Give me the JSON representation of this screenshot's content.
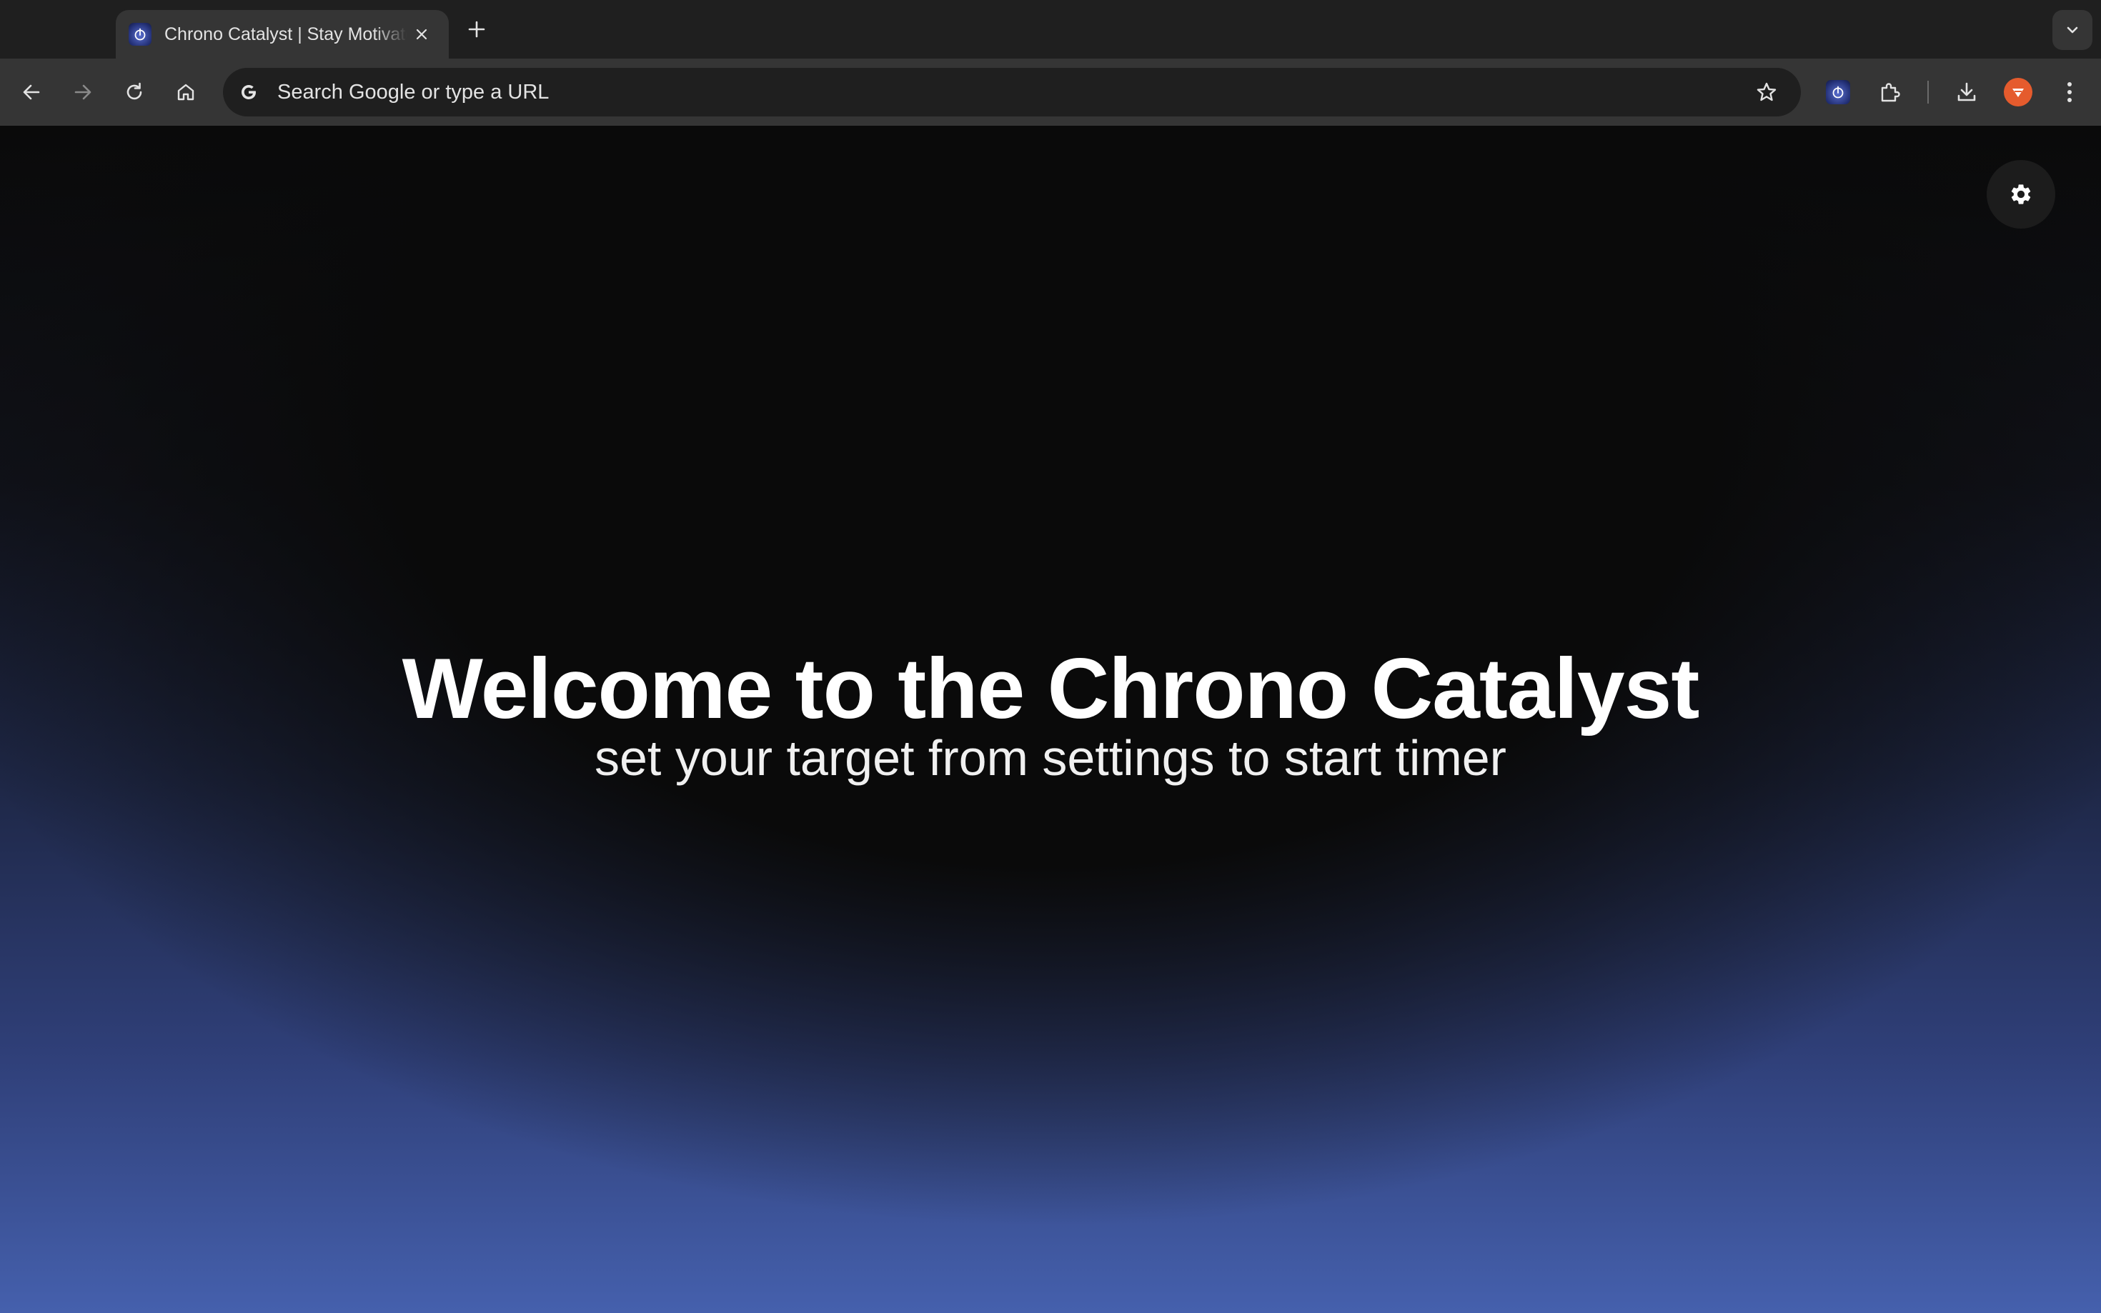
{
  "browser": {
    "tab": {
      "title": "Chrono Catalyst | Stay Motivated",
      "favicon_icon": "stopwatch-icon"
    },
    "toolbar": {
      "omnibox_placeholder": "Search Google or type a URL"
    },
    "colors": {
      "tabstrip": "#1f1f1f",
      "toolbar": "#353535",
      "omnibox": "#1f1f1f",
      "profile_avatar": "#e55b2d"
    }
  },
  "page": {
    "title": "Welcome to the Chrono Catalyst",
    "subtitle": "set your target from settings to start timer",
    "settings_icon": "gear-icon",
    "colors": {
      "background_top": "#0a0a0a",
      "background_bottom": "#4560ad",
      "text": "#ffffff"
    }
  }
}
